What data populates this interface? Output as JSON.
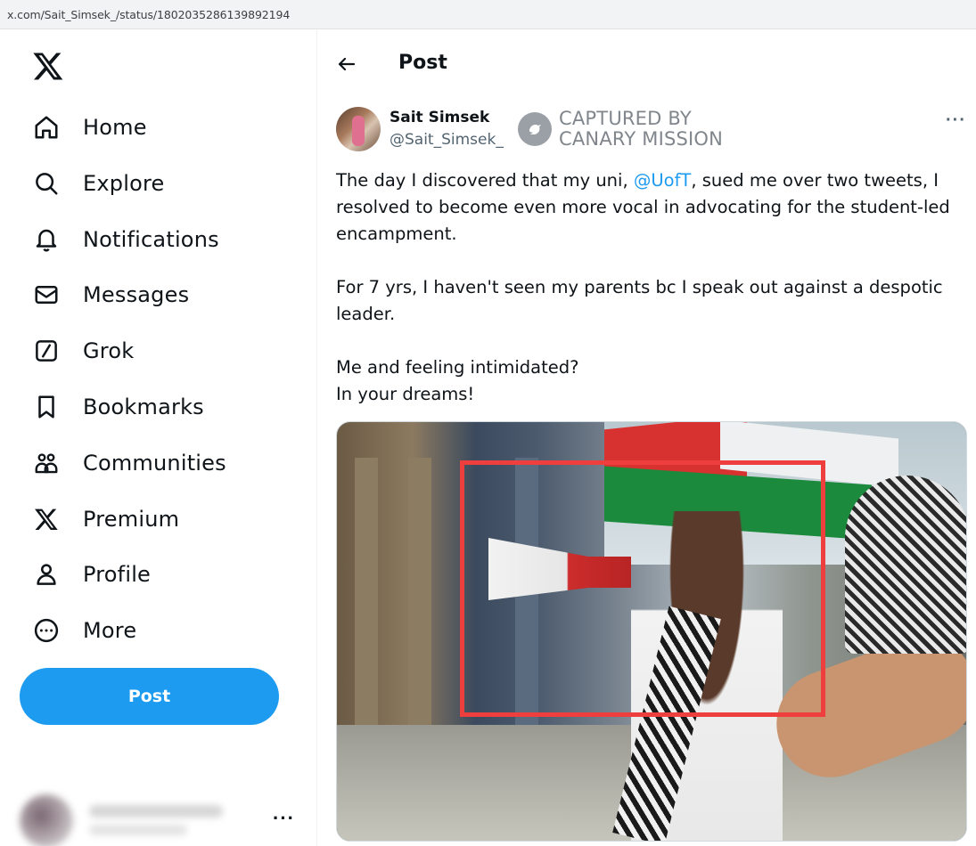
{
  "browser": {
    "url": "x.com/Sait_Simsek_/status/1802035286139892194"
  },
  "sidebar": {
    "items": [
      {
        "label": "Home",
        "icon": "home-icon"
      },
      {
        "label": "Explore",
        "icon": "search-icon"
      },
      {
        "label": "Notifications",
        "icon": "bell-icon"
      },
      {
        "label": "Messages",
        "icon": "envelope-icon"
      },
      {
        "label": "Grok",
        "icon": "grok-icon"
      },
      {
        "label": "Bookmarks",
        "icon": "bookmark-icon"
      },
      {
        "label": "Communities",
        "icon": "communities-icon"
      },
      {
        "label": "Premium",
        "icon": "x-logo-icon"
      },
      {
        "label": "Profile",
        "icon": "person-icon"
      },
      {
        "label": "More",
        "icon": "more-circle-icon"
      }
    ],
    "post_button": "Post",
    "account_more": "···"
  },
  "header": {
    "title": "Post"
  },
  "tweet": {
    "author_name": "Sait Simsek",
    "author_handle": "@Sait_Simsek_",
    "more": "···",
    "watermark_line1": "CAPTURED BY",
    "watermark_line2": "CANARY MISSION",
    "text_p1_before": "The day I discovered that my uni, ",
    "text_p1_mention": "@UofT",
    "text_p1_after": ", sued me over two tweets, I resolved to become even more vocal in advocating for the student-led encampment.",
    "text_p2": "For 7 yrs, I haven't seen my parents bc I speak out against a despotic leader.",
    "text_p3_line1": "Me and feeling intimidated?",
    "text_p3_line2": "In your dreams!",
    "highlight_color": "#ef3e3e"
  },
  "colors": {
    "accent": "#1d9bf0",
    "text": "#0f1419",
    "secondary": "#536471"
  }
}
